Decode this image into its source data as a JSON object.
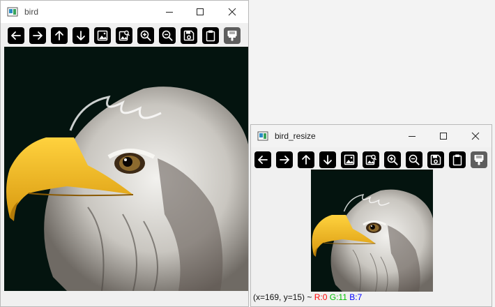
{
  "windows": {
    "bird": {
      "title": "bird",
      "controls": [
        "minimize-icon",
        "maximize-icon",
        "close-icon"
      ]
    },
    "bird_resize": {
      "title": "bird_resize",
      "controls": [
        "minimize-icon",
        "maximize-icon",
        "close-icon"
      ],
      "status": {
        "coords": "(x=169, y=15) ~",
        "r": "R:0",
        "g": "G:11",
        "b": "B:7",
        "colors": {
          "r": "#ff0000",
          "g": "#00c000",
          "b": "#0000ff"
        }
      }
    }
  },
  "toolbar_icons": [
    "arrow-left-icon",
    "arrow-right-icon",
    "arrow-up-icon",
    "arrow-down-icon",
    "image-icon",
    "image-search-icon",
    "zoom-in-icon",
    "zoom-out-icon",
    "save-icon",
    "clipboard-icon",
    "properties-icon"
  ],
  "colors": {
    "image_background": "#04140f",
    "beak": "#f0b21c",
    "toolbar_button": "#000000",
    "toolbar_button_disabled": "#5e5e5e"
  }
}
